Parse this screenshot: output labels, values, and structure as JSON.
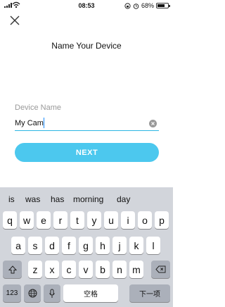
{
  "status": {
    "time": "08:53",
    "battery": "68%",
    "battery_level": 0.68
  },
  "header": {
    "title": "Name Your Device"
  },
  "form": {
    "label": "Device Name",
    "value": "My Cam",
    "next_label": "NEXT"
  },
  "keyboard": {
    "suggestions": [
      "is",
      "was",
      "has",
      "morning",
      "day"
    ],
    "row1": [
      "q",
      "w",
      "e",
      "r",
      "t",
      "y",
      "u",
      "i",
      "o",
      "p"
    ],
    "row2": [
      "a",
      "s",
      "d",
      "f",
      "g",
      "h",
      "j",
      "k",
      "l"
    ],
    "row3": [
      "z",
      "x",
      "c",
      "v",
      "b",
      "n",
      "m"
    ],
    "numbers_label": "123",
    "space_label": "空格",
    "next_line_label": "下一项"
  },
  "icons": [
    "signal-icon",
    "wifi-icon",
    "lock-rotation-icon",
    "alarm-icon",
    "battery-icon",
    "close-icon",
    "clear-icon",
    "shift-icon",
    "backspace-icon",
    "globe-icon",
    "microphone-icon"
  ],
  "colors": {
    "accent": "#2bb5e3",
    "button": "#4cc8ee",
    "keyboard_bg": "#d2d5db"
  }
}
